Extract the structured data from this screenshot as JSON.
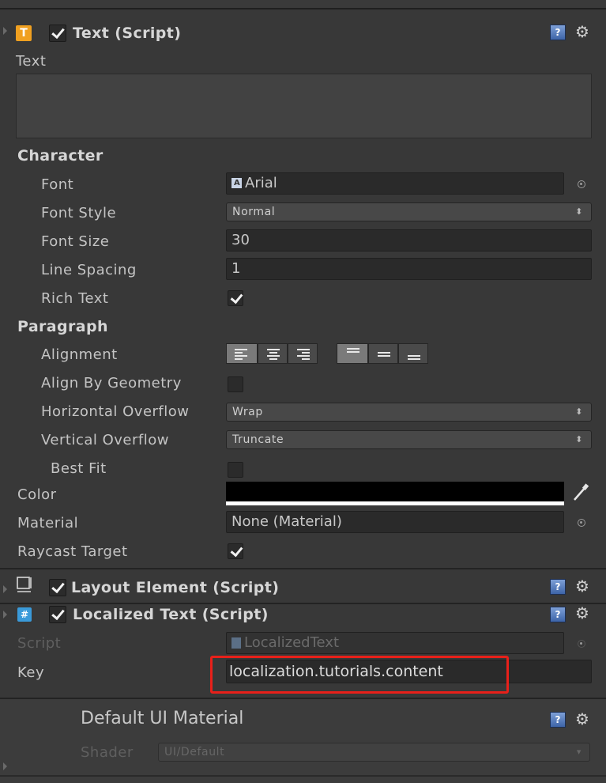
{
  "text_component": {
    "title": "Text (Script)",
    "text_label": "Text",
    "text_value": "",
    "character_header": "Character",
    "font": {
      "label": "Font",
      "value": "Arial"
    },
    "font_style": {
      "label": "Font Style",
      "value": "Normal"
    },
    "font_size": {
      "label": "Font Size",
      "value": "30"
    },
    "line_spacing": {
      "label": "Line Spacing",
      "value": "1"
    },
    "rich_text": {
      "label": "Rich Text",
      "checked": true
    },
    "paragraph_header": "Paragraph",
    "alignment": {
      "label": "Alignment",
      "horizontal_selected": "left",
      "vertical_selected": "top"
    },
    "align_by_geometry": {
      "label": "Align By Geometry",
      "checked": false
    },
    "horizontal_overflow": {
      "label": "Horizontal Overflow",
      "value": "Wrap"
    },
    "vertical_overflow": {
      "label": "Vertical Overflow",
      "value": "Truncate"
    },
    "best_fit": {
      "label": "Best Fit",
      "checked": false
    },
    "color": {
      "label": "Color",
      "value": "#000000"
    },
    "material": {
      "label": "Material",
      "value": "None (Material)"
    },
    "raycast_target": {
      "label": "Raycast Target",
      "checked": true
    }
  },
  "layout_element": {
    "title": "Layout Element (Script)"
  },
  "localized_text": {
    "title": "Localized Text (Script)",
    "script": {
      "label": "Script",
      "value": "LocalizedText"
    },
    "key": {
      "label": "Key",
      "value": "localization.tutorials.content"
    }
  },
  "material_section": {
    "title": "Default UI Material",
    "shader": {
      "label": "Shader",
      "value": "UI/Default"
    }
  },
  "colors": {
    "background": "#383838",
    "field": "#2a2a2a",
    "highlight_box": "#e8201a",
    "text_icon": "#f0a020",
    "script_icon": "#3a9ad9"
  }
}
